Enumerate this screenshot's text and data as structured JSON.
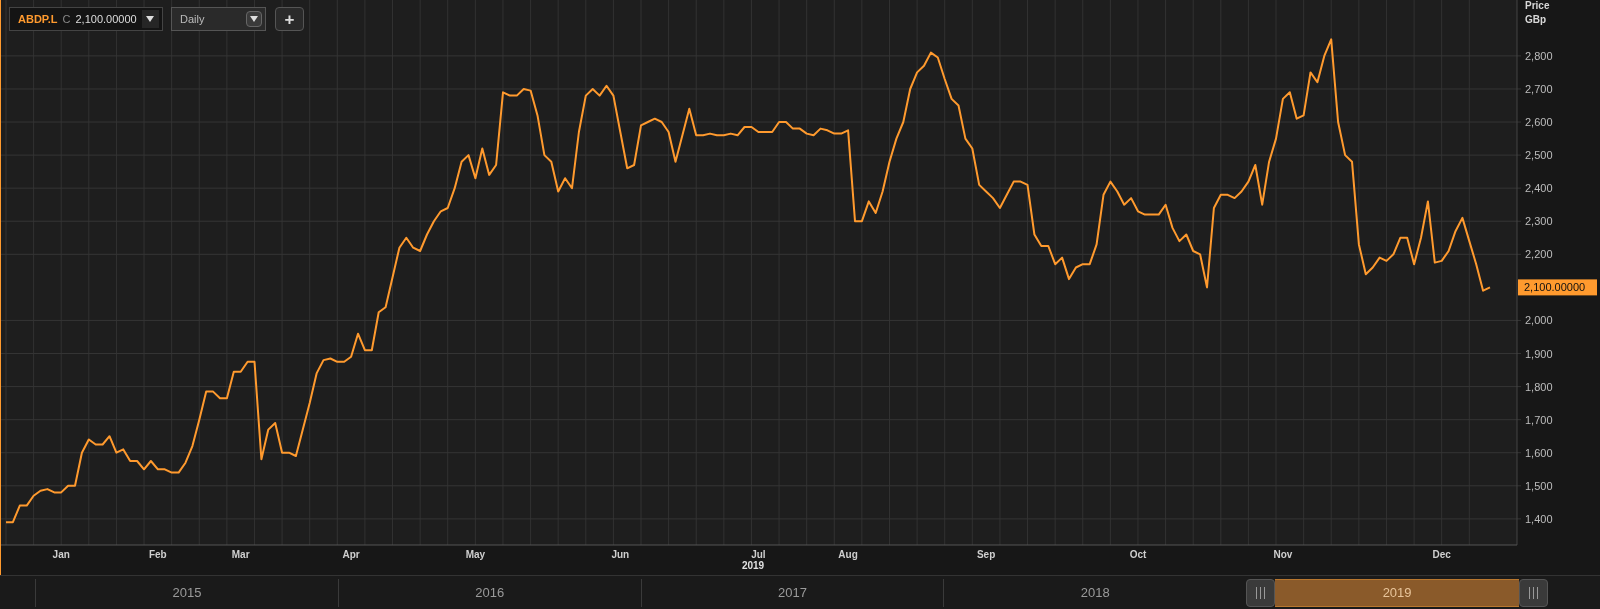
{
  "toolbar": {
    "price_type": "C",
    "price": "2,100.00000",
    "interval": "Daily",
    "add_button": "+"
  },
  "price_axis": {
    "title": "Price",
    "unit": "GBp"
  },
  "last_price_label": "2,100.00000",
  "chart": {
    "chart_data": {
      "type": "line",
      "grid": true,
      "xlabel": "2019",
      "ylim": [
        1321,
        2969
      ],
      "categories": [
        null,
        null,
        null,
        null,
        null,
        null,
        null,
        null,
        "Jan",
        null,
        null,
        null,
        null,
        null,
        null,
        null,
        null,
        null,
        null,
        null,
        null,
        null,
        "Feb",
        null,
        null,
        null,
        null,
        null,
        null,
        null,
        null,
        null,
        null,
        null,
        "Mar",
        null,
        null,
        null,
        null,
        null,
        null,
        null,
        null,
        null,
        null,
        null,
        null,
        null,
        null,
        null,
        "Apr",
        null,
        null,
        null,
        null,
        null,
        null,
        null,
        null,
        null,
        null,
        null,
        null,
        null,
        null,
        null,
        null,
        null,
        "May",
        null,
        null,
        null,
        null,
        null,
        null,
        null,
        null,
        null,
        null,
        null,
        null,
        null,
        null,
        null,
        null,
        null,
        null,
        null,
        null,
        "Jun",
        null,
        null,
        null,
        null,
        null,
        null,
        null,
        null,
        null,
        null,
        null,
        null,
        null,
        null,
        null,
        null,
        null,
        null,
        null,
        "Jul",
        null,
        null,
        null,
        null,
        null,
        null,
        null,
        null,
        null,
        null,
        null,
        null,
        "Aug",
        null,
        null,
        null,
        null,
        null,
        null,
        null,
        null,
        null,
        null,
        null,
        null,
        null,
        null,
        null,
        null,
        null,
        null,
        null,
        "Sep",
        null,
        null,
        null,
        null,
        null,
        null,
        null,
        null,
        null,
        null,
        null,
        null,
        null,
        null,
        null,
        null,
        null,
        null,
        null,
        null,
        null,
        "Oct",
        null,
        null,
        null,
        null,
        null,
        null,
        null,
        null,
        null,
        null,
        null,
        null,
        null,
        null,
        null,
        null,
        null,
        null,
        null,
        null,
        "Nov",
        null,
        null,
        null,
        null,
        null,
        null,
        null,
        null,
        null,
        null,
        null,
        null,
        null,
        null,
        null,
        null,
        null,
        null,
        null,
        null,
        null,
        null,
        "Dec",
        null,
        null,
        null,
        null,
        null,
        null,
        null
      ],
      "yticks": [
        {
          "value": 1400,
          "label": "1,400"
        },
        {
          "value": 1500,
          "label": "1,500"
        },
        {
          "value": 1600,
          "label": "1,600"
        },
        {
          "value": 1700,
          "label": "1,700"
        },
        {
          "value": 1800,
          "label": "1,800"
        },
        {
          "value": 1900,
          "label": "1,900"
        },
        {
          "value": 2000,
          "label": "2,000"
        },
        {
          "value": 2200,
          "label": "2,200"
        },
        {
          "value": 2300,
          "label": "2,300"
        },
        {
          "value": 2400,
          "label": "2,400"
        },
        {
          "value": 2500,
          "label": "2,500"
        },
        {
          "value": 2600,
          "label": "2,600"
        },
        {
          "value": 2700,
          "label": "2,700"
        },
        {
          "value": 2800,
          "label": "2,800"
        }
      ],
      "series": [
        {
          "name": "ABDP.L",
          "color": "#ff9a2e",
          "values": [
            1390,
            1390,
            1440,
            1440,
            1470,
            1485,
            1490,
            1480,
            1480,
            1500,
            1500,
            1600,
            1640,
            1625,
            1625,
            1650,
            1600,
            1610,
            1575,
            1575,
            1550,
            1575,
            1550,
            1550,
            1540,
            1540,
            1570,
            1620,
            1700,
            1785,
            1785,
            1765,
            1765,
            1845,
            1845,
            1875,
            1875,
            1580,
            1670,
            1690,
            1600,
            1600,
            1590,
            1670,
            1750,
            1840,
            1880,
            1885,
            1875,
            1875,
            1890,
            1960,
            1910,
            1910,
            2025,
            2040,
            2130,
            2220,
            2250,
            2220,
            2210,
            2260,
            2300,
            2330,
            2340,
            2400,
            2480,
            2500,
            2430,
            2520,
            2440,
            2470,
            2690,
            2680,
            2680,
            2700,
            2695,
            2620,
            2500,
            2480,
            2390,
            2430,
            2400,
            2570,
            2680,
            2700,
            2680,
            2710,
            2680,
            2570,
            2460,
            2470,
            2590,
            2600,
            2610,
            2600,
            2570,
            2480,
            2560,
            2640,
            2560,
            2560,
            2565,
            2560,
            2560,
            2565,
            2560,
            2585,
            2585,
            2570,
            2570,
            2570,
            2600,
            2600,
            2580,
            2580,
            2565,
            2560,
            2580,
            2575,
            2565,
            2565,
            2575,
            2300,
            2300,
            2360,
            2325,
            2390,
            2480,
            2550,
            2600,
            2700,
            2750,
            2770,
            2810,
            2795,
            2730,
            2670,
            2650,
            2550,
            2520,
            2410,
            2390,
            2370,
            2340,
            2380,
            2420,
            2420,
            2410,
            2260,
            2225,
            2225,
            2170,
            2190,
            2125,
            2160,
            2170,
            2170,
            2230,
            2380,
            2420,
            2390,
            2350,
            2370,
            2330,
            2320,
            2320,
            2320,
            2350,
            2280,
            2240,
            2260,
            2210,
            2200,
            2100,
            2340,
            2380,
            2380,
            2370,
            2390,
            2420,
            2470,
            2350,
            2480,
            2550,
            2670,
            2690,
            2610,
            2620,
            2750,
            2720,
            2800,
            2850,
            2600,
            2500,
            2480,
            2230,
            2140,
            2160,
            2190,
            2180,
            2200,
            2250,
            2250,
            2170,
            2250,
            2360,
            2175,
            2180,
            2210,
            2270,
            2310,
            2240,
            2170,
            2090,
            2100
          ]
        }
      ]
    }
  },
  "navigator": {
    "years": [
      {
        "label": "2015",
        "selected": false
      },
      {
        "label": "2016",
        "selected": false
      },
      {
        "label": "2017",
        "selected": false
      },
      {
        "label": "2018",
        "selected": false
      },
      {
        "label": "2019",
        "selected": true
      }
    ]
  }
}
